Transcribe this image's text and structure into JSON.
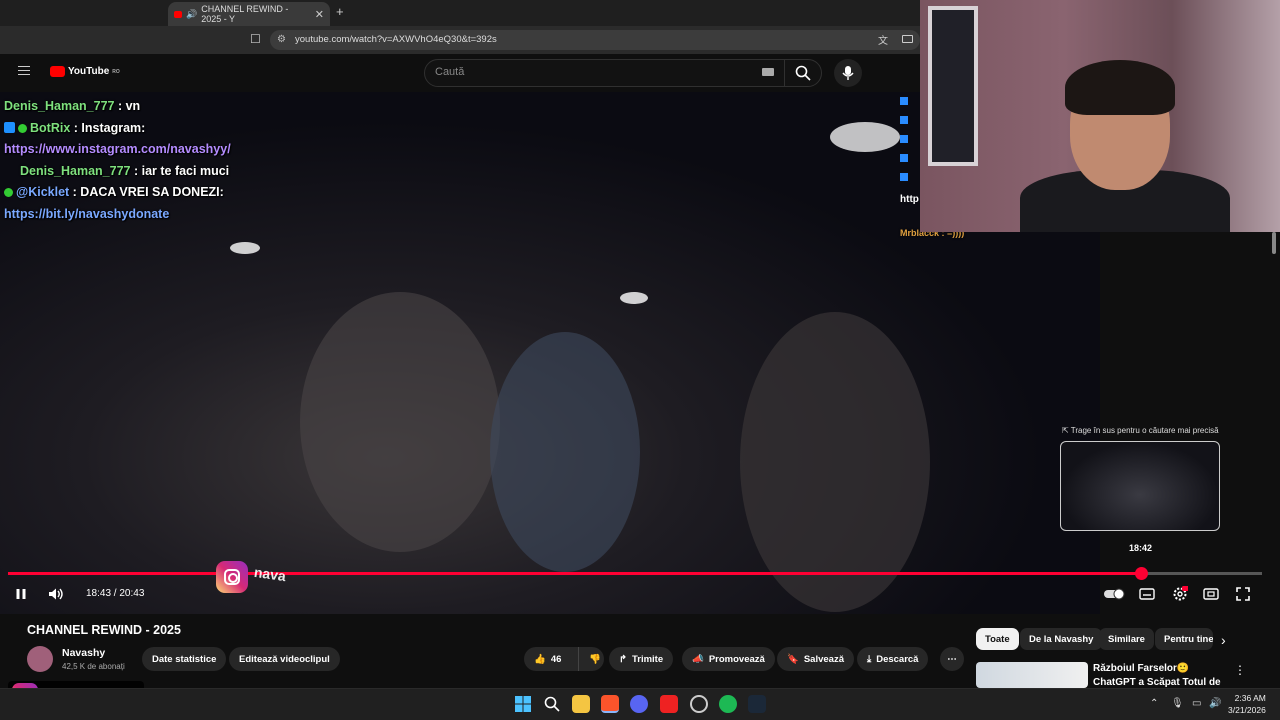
{
  "browser": {
    "tab_title": "CHANNEL REWIND - 2025 - Y",
    "url": "youtube.com/watch?v=AXWVhO4eQ30&t=392s"
  },
  "youtube": {
    "logo": "YouTube",
    "logo_region": "RO",
    "search_placeholder": "Caută"
  },
  "chat_overlay": [
    {
      "user": "Denis_Haman_777",
      "text": " : vn"
    },
    {
      "user": "BotRix",
      "text": " : Instagram:"
    },
    {
      "user": "",
      "text": "https://www.instagram.com/navashyy/"
    },
    {
      "user": "Denis_Haman_777",
      "text": " : iar te faci muci"
    },
    {
      "user": "@Kicklet",
      "text": " : DACA VREI SA DONEZI:"
    },
    {
      "user": "",
      "text": "https://bit.ly/navashydonate"
    }
  ],
  "side_chat": {
    "url_fragment": "http",
    "user": "Mrblacck",
    "text": " : =))))"
  },
  "player": {
    "current_time": "18:43",
    "duration": "20:43",
    "time_display": "18:43 / 20:43",
    "progress_fraction": 0.904,
    "preview_hint": "⇱ Trage în sus pentru o căutare mai precisă",
    "preview_time": "18:42",
    "overlay_handle": "nava"
  },
  "video": {
    "title": "CHANNEL REWIND - 2025",
    "channel": "Navashy",
    "subscribers": "42,5 K de abonați",
    "likes": "46"
  },
  "actions": {
    "stats": "Date statistice",
    "edit": "Editează videoclipul",
    "share": "Trimite",
    "promote": "Promovează",
    "save": "Salvează",
    "download": "Descarcă"
  },
  "chips": [
    "Toate",
    "De la Navashy",
    "Similare",
    "Pentru tine"
  ],
  "recommendation": {
    "title": "Războiul Farselor🙂 ChatGPT a Scăpat Totul de Sub Control..."
  },
  "instagram_handle": "navashyy",
  "clock": {
    "time": "2:36 AM",
    "date": "3/21/2026"
  },
  "colors": {
    "accent": "#ff0033",
    "youtube_red": "#ff0000"
  }
}
